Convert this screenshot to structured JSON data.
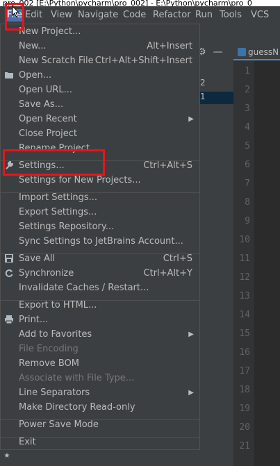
{
  "window": {
    "title": "pro_002 [E:\\Python\\pycharm\\pro_002] - E:\\Python\\pycharm\\pro_0"
  },
  "menubar": [
    "File",
    "Edit",
    "View",
    "Navigate",
    "Code",
    "Refactor",
    "Run",
    "Tools",
    "VCS"
  ],
  "editor": {
    "tab_label": "guessN",
    "line_numbers": [
      "1",
      "2",
      "3",
      "4",
      "5",
      "6",
      "7",
      "8",
      "9",
      "10",
      "11",
      "12",
      "13",
      "14",
      "15",
      "16",
      "17",
      "18",
      "19",
      "20",
      "21"
    ]
  },
  "project_panel": {
    "rows": [
      "2",
      "1"
    ]
  },
  "side_strip": {
    "label": "2:",
    "star": "★"
  },
  "file_menu": {
    "items": [
      {
        "label": "New Project...",
        "shortcut": ""
      },
      {
        "label": "New...",
        "shortcut": "Alt+Insert"
      },
      {
        "label": "New Scratch File",
        "shortcut": "Ctrl+Alt+Shift+Insert"
      },
      {
        "label": "Open...",
        "shortcut": "",
        "icon": "folder-icon"
      },
      {
        "label": "Open URL...",
        "shortcut": ""
      },
      {
        "label": "Save As...",
        "shortcut": ""
      },
      {
        "label": "Open Recent",
        "shortcut": "",
        "submenu": true
      },
      {
        "label": "Close Project",
        "shortcut": ""
      },
      {
        "label": "Rename Project...",
        "shortcut": ""
      },
      {
        "label": "Settings...",
        "shortcut": "Ctrl+Alt+S",
        "icon": "wrench-icon"
      },
      {
        "label": "Settings for New Projects...",
        "shortcut": ""
      },
      {
        "label": "Import Settings...",
        "shortcut": ""
      },
      {
        "label": "Export Settings...",
        "shortcut": ""
      },
      {
        "label": "Settings Repository...",
        "shortcut": ""
      },
      {
        "label": "Sync Settings to JetBrains Account...",
        "shortcut": ""
      },
      {
        "label": "Save All",
        "shortcut": "Ctrl+S",
        "icon": "save-icon"
      },
      {
        "label": "Synchronize",
        "shortcut": "Ctrl+Alt+Y",
        "icon": "sync-icon"
      },
      {
        "label": "Invalidate Caches / Restart...",
        "shortcut": ""
      },
      {
        "label": "Export to HTML...",
        "shortcut": ""
      },
      {
        "label": "Print...",
        "shortcut": "",
        "icon": "print-icon"
      },
      {
        "label": "Add to Favorites",
        "shortcut": "",
        "submenu": true
      },
      {
        "label": "File Encoding",
        "shortcut": "",
        "disabled": true
      },
      {
        "label": "Remove BOM",
        "shortcut": ""
      },
      {
        "label": "Associate with File Type...",
        "shortcut": "",
        "disabled": true
      },
      {
        "label": "Line Separators",
        "shortcut": "",
        "submenu": true
      },
      {
        "label": "Make Directory Read-only",
        "shortcut": ""
      },
      {
        "label": "Power Save Mode",
        "shortcut": ""
      },
      {
        "label": "Exit",
        "shortcut": ""
      }
    ]
  },
  "colors": {
    "highlight_box": "#e8141c",
    "menu_bg": "#3c3f41",
    "active_menu": "#4b6eaf"
  }
}
